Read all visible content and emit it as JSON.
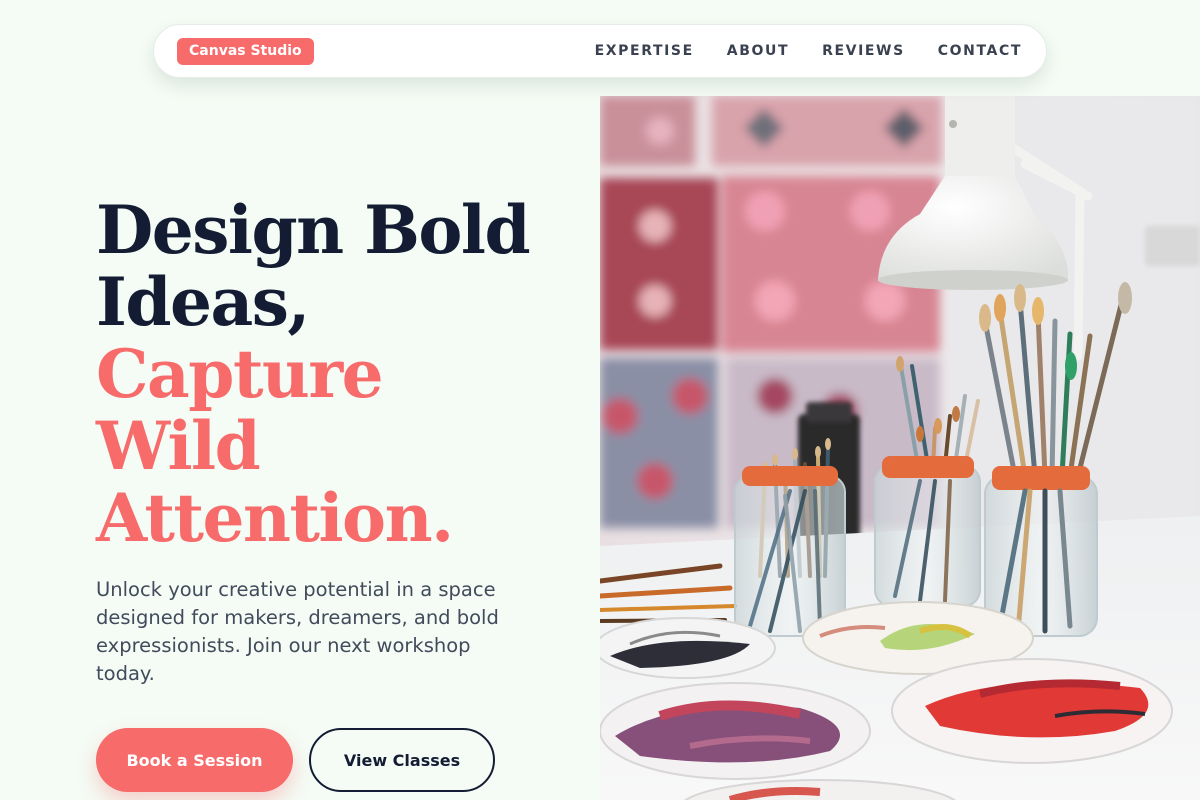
{
  "brand": {
    "name": "Canvas Studio"
  },
  "nav": {
    "links": [
      "EXPERTISE",
      "ABOUT",
      "REVIEWS",
      "CONTACT"
    ]
  },
  "hero": {
    "headline": {
      "line1": "Design Bold",
      "line2": "Ideas,",
      "line3": "Capture",
      "line4": "Wild",
      "line5": "Attention."
    },
    "lead": "Unlock your creative potential in a space designed for makers, dreamers, and bold expressionists. Join our next workshop today.",
    "primary_cta": "Book a Session",
    "secondary_cta": "View Classes",
    "image_subject": "art studio with paintbrushes in jars, paint palettes and a desk lamp"
  },
  "colors": {
    "background": "#f4fcf5",
    "accent": "#f76b6b",
    "heading": "#131c33",
    "body_text": "#424b5b"
  }
}
